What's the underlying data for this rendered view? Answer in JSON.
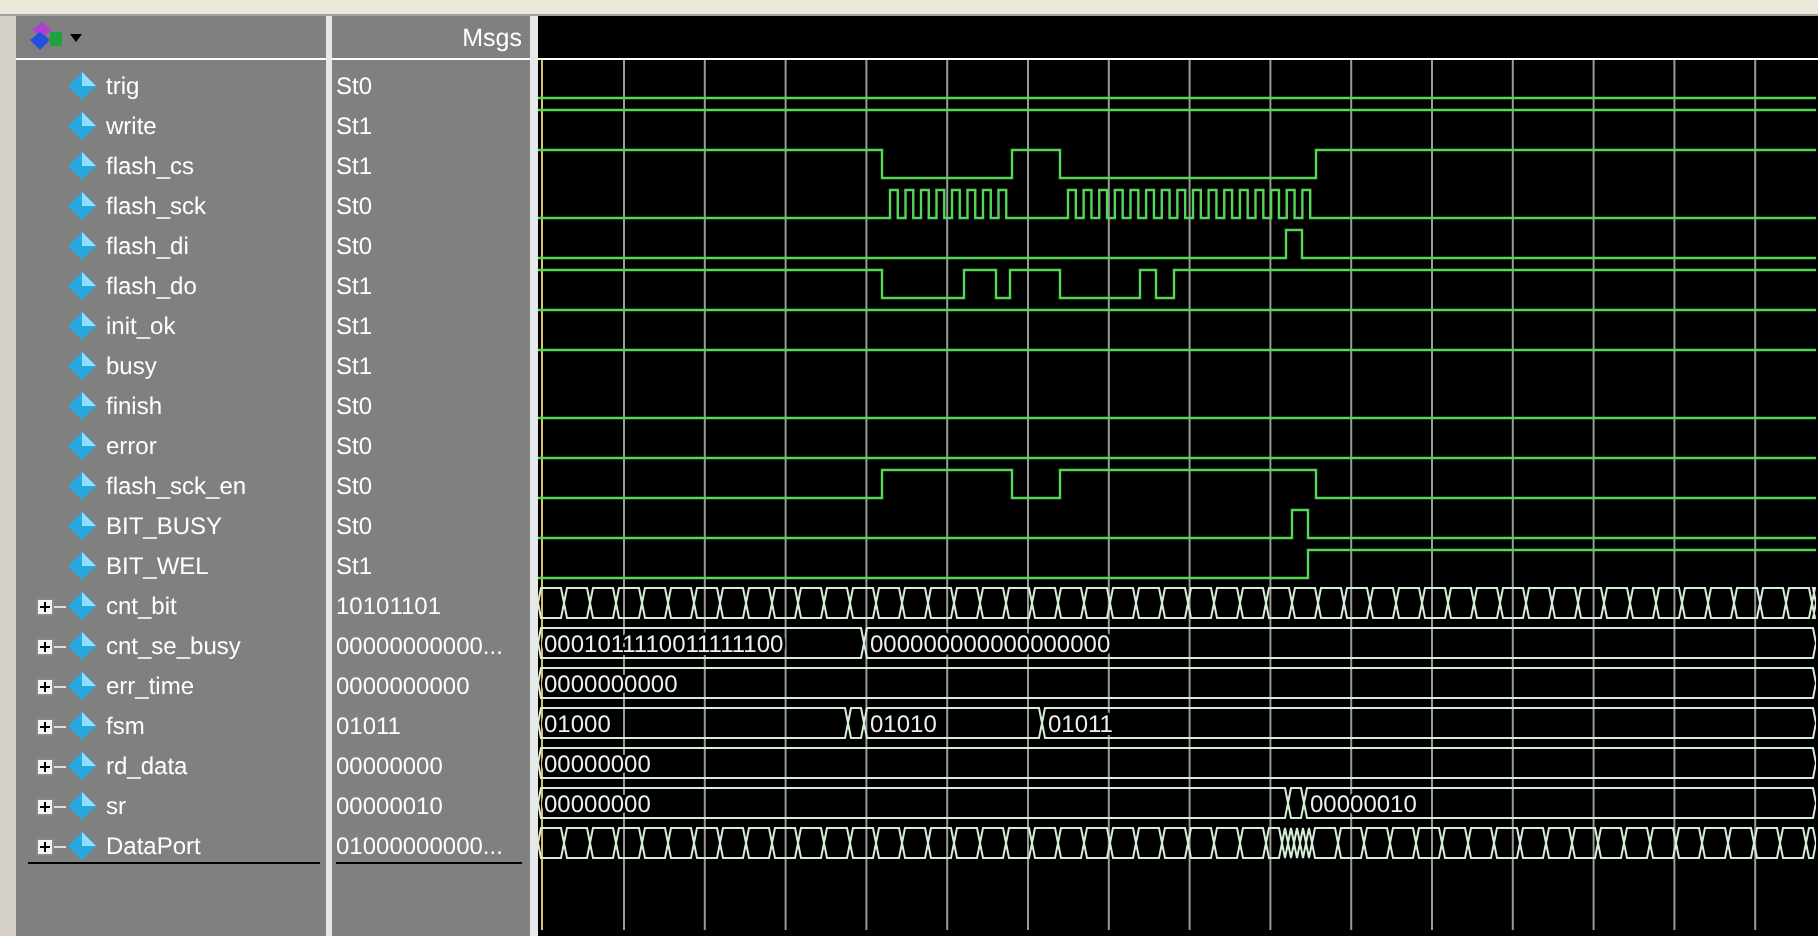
{
  "header": {
    "values_title": "Msgs"
  },
  "signals": [
    {
      "name": "trig",
      "value": "St0",
      "kind": "scalar"
    },
    {
      "name": "write",
      "value": "St1",
      "kind": "scalar"
    },
    {
      "name": "flash_cs",
      "value": "St1",
      "kind": "scalar"
    },
    {
      "name": "flash_sck",
      "value": "St0",
      "kind": "scalar"
    },
    {
      "name": "flash_di",
      "value": "St0",
      "kind": "scalar"
    },
    {
      "name": "flash_do",
      "value": "St1",
      "kind": "scalar"
    },
    {
      "name": "init_ok",
      "value": "St1",
      "kind": "scalar"
    },
    {
      "name": "busy",
      "value": "St1",
      "kind": "scalar"
    },
    {
      "name": "finish",
      "value": "St0",
      "kind": "scalar"
    },
    {
      "name": "error",
      "value": "St0",
      "kind": "scalar"
    },
    {
      "name": "flash_sck_en",
      "value": "St0",
      "kind": "scalar"
    },
    {
      "name": "BIT_BUSY",
      "value": "St0",
      "kind": "scalar"
    },
    {
      "name": "BIT_WEL",
      "value": "St1",
      "kind": "scalar"
    },
    {
      "name": "cnt_bit",
      "value": "10101101",
      "kind": "bus",
      "expanded": false
    },
    {
      "name": "cnt_se_busy",
      "value": "00000000000...",
      "kind": "bus",
      "expanded": false,
      "wave_labels": [
        "0001011110011111100",
        "000000000000000000"
      ]
    },
    {
      "name": "err_time",
      "value": "0000000000",
      "kind": "bus",
      "expanded": false,
      "wave_labels": [
        "0000000000"
      ]
    },
    {
      "name": "fsm",
      "value": "01011",
      "kind": "bus",
      "expanded": false,
      "wave_labels": [
        "01000",
        "01010",
        "01011"
      ]
    },
    {
      "name": "rd_data",
      "value": "00000000",
      "kind": "bus",
      "expanded": false,
      "wave_labels": [
        "00000000"
      ]
    },
    {
      "name": "sr",
      "value": "00000010",
      "kind": "bus",
      "expanded": false,
      "wave_labels": [
        "00000000",
        "00000010"
      ]
    },
    {
      "name": "DataPort",
      "value": "01000000000...",
      "kind": "bus",
      "expanded": false
    }
  ]
}
